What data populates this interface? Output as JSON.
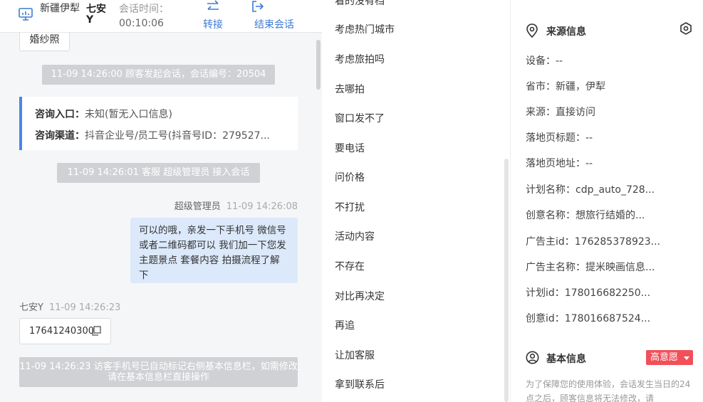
{
  "header": {
    "location": "新疆伊犁",
    "visitor_name": "七安Y",
    "time_label": "会话时间：",
    "time_value": "00:10:06",
    "transfer_label": "转接",
    "end_label": "结束会话"
  },
  "chat": {
    "tag_chip": "婚纱照",
    "sys_start": "11-09 14:26:00 顾客发起会话，会话编号：20504",
    "consult": {
      "entry_label": "咨询入口：",
      "entry_value": "未知(暂无入口信息)",
      "channel_label": "咨询渠道：",
      "channel_value": "抖音企业号/员工号(抖音号ID：279527..."
    },
    "sys_join": "11-09 14:26:01 客服 超级管理员 接入会话",
    "agent_name": "超级管理员",
    "agent_time": "11-09 14:26:08",
    "agent_msg": "可以的哦，亲发一下手机号 微信号或者二维码都可以 我们加一下您发主题景点 套餐内容 拍摄流程了解下",
    "visitor_name": "七安Y",
    "visitor_time": "11-09 14:26:23",
    "visitor_msg": "17641240300",
    "sys_phone": "11-09 14:26:23 访客手机号已自动标记右侧基本信息栏，如需修改请在基本信息栏直接操作"
  },
  "quick_replies": [
    "看的没有档",
    "考虑热门城市",
    "考虑旅拍吗",
    "去哪拍",
    "窗口发不了",
    "要电话",
    "问价格",
    "不打扰",
    "活动内容",
    "不存在",
    "对比再决定",
    "再追",
    "让加客服",
    "拿到联系后"
  ],
  "source_info": {
    "title": "来源信息",
    "rows": [
      "设备：--",
      "省市：新疆，伊犁",
      "来源：直接访问",
      "落地页标题：--",
      "落地页地址：--",
      "计划名称：cdp_auto_728...",
      "创意名称：想旅行结婚的...",
      "广告主id：176285378923...",
      "广告主名称：提米映画信息...",
      "计划id：178016682250...",
      "创意id：178016687524..."
    ]
  },
  "basic_info": {
    "title": "基本信息",
    "badge": "高意愿",
    "note": "为了保障您的使用体验，会话发生当日的24点之后，顾客信息将无法修改，请"
  },
  "colors": {
    "accent": "#3a7bd5",
    "agent_bubble": "#dce9fb",
    "badge": "#f0505a",
    "system_pill": "#cfd1d4"
  }
}
